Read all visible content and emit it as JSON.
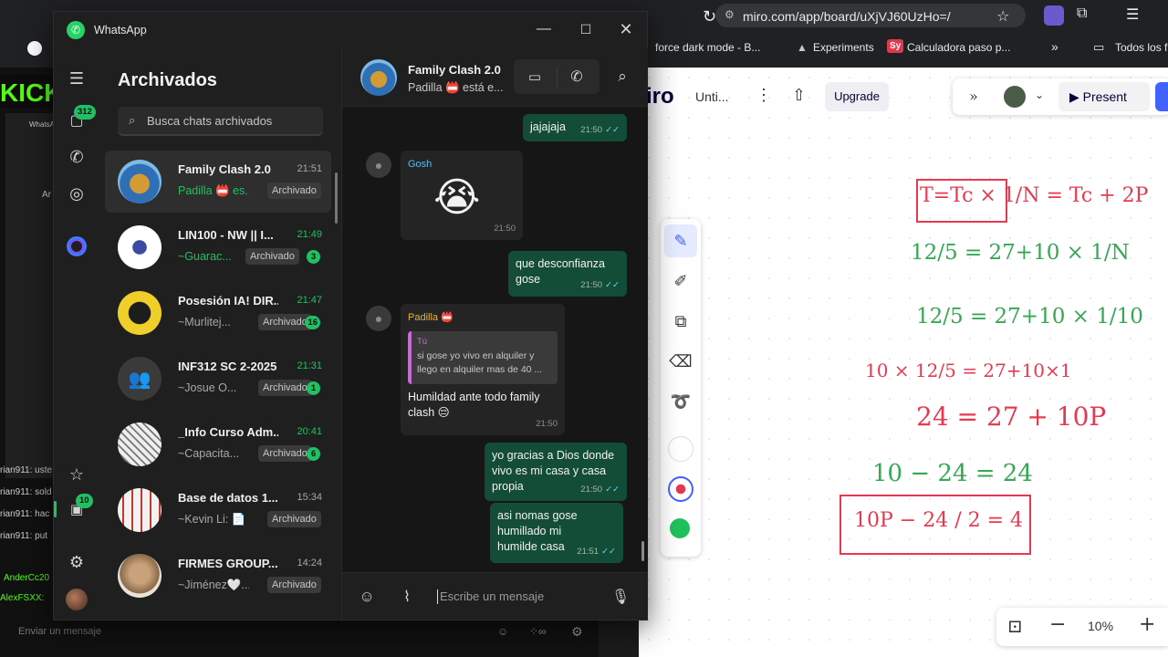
{
  "browser": {
    "url": "miro.com/app/board/uXjVJ60UzHo=/",
    "bookmarks": [
      "force dark mode - B...",
      "Experiments",
      "Calculadora paso p...",
      "Todos los f"
    ],
    "bookmark_badge": "Sy"
  },
  "stream_bg": {
    "logo": "KICK",
    "chat_lines": [
      "rian911: uste",
      "rian911: sold",
      "rian911: hac",
      "rian911: put",
      "AnderCc20",
      "AlexFSXX:"
    ],
    "input_placeholder": "Enviar un mensaje",
    "mini_title": "WhatsA",
    "mini_heading": "Ar"
  },
  "miro": {
    "logo": "iro",
    "board_name": "Unti...",
    "upgrade_label": "Upgrade",
    "present_label": "Present",
    "zoom": "10%",
    "handwriting": [
      {
        "text": "T=Tc × 1/N = Tc + 2P",
        "color": "red"
      },
      {
        "text": "12/5 = 27+10 × 1/N",
        "color": "green"
      },
      {
        "text": "12/5 = 27+10 × 1/10",
        "color": "green"
      },
      {
        "text": "10 × 12/5 = 27+10×1",
        "color": "red"
      },
      {
        "text": "24 = 27 + 10P",
        "color": "red"
      },
      {
        "text": "10 − 24 = 24",
        "color": "green"
      },
      {
        "text": "10P − 24 / 2 = 4",
        "color": "red"
      }
    ]
  },
  "whatsapp": {
    "app_title": "WhatsApp",
    "rail": {
      "chats_badge": "312",
      "archive_badge": "10"
    },
    "list_title": "Archivados",
    "search_placeholder": "Busca chats archivados",
    "archived_label": "Archivado",
    "chats": [
      {
        "name": "Family Clash 2.0",
        "time": "21:51",
        "preview": "Padilla 📛 es...",
        "unread": "",
        "preview_green": true
      },
      {
        "name": "LIN100 - NW || I...",
        "time": "21:49",
        "preview": "~Guarac...",
        "unread": "3",
        "preview_green": true
      },
      {
        "name": "Posesión IA! DIR...",
        "time": "21:47",
        "preview": "~Murlitej...",
        "unread": "16",
        "preview_green": false
      },
      {
        "name": "INF312 SC 2-2025",
        "time": "21:31",
        "preview": "~Josue O...",
        "unread": "1",
        "preview_green": false
      },
      {
        "name": "_Info Curso Adm...",
        "time": "20:41",
        "preview": "~Capacita...",
        "unread": "6",
        "preview_green": false
      },
      {
        "name": "Base de datos 1...",
        "time": "15:34",
        "preview": "~Kevin Li: 📄 ...",
        "unread": "",
        "preview_green": false
      },
      {
        "name": "FIRMES GROUP...",
        "time": "14:24",
        "preview": "~Jiménez🤍...",
        "unread": "",
        "preview_green": false
      }
    ],
    "chat": {
      "title": "Family Clash 2.0",
      "subtitle": "Padilla 📛 está e...",
      "input_placeholder": "Escribe un mensaje",
      "messages": [
        {
          "dir": "out",
          "text": "jajajaja",
          "time": "21:50"
        },
        {
          "dir": "in",
          "sender": "Gosh",
          "emoji": "😭",
          "time": "21:50"
        },
        {
          "dir": "out",
          "text": "que desconfianza gose",
          "time": "21:50"
        },
        {
          "dir": "in",
          "sender": "Padilla 📛",
          "quote_author": "Tú",
          "quote_text": "si gose yo vivo en alquiler y llego en alquiler mas de 40 ...",
          "text": "Humildad ante todo family clash 😔",
          "time": "21:50"
        },
        {
          "dir": "out",
          "text": "yo gracias a Dios donde vivo es mi casa y casa propia",
          "time": "21:50"
        },
        {
          "dir": "out",
          "text": "asi nomas gose humillado mi humilde casa",
          "time": "21:51"
        }
      ]
    }
  }
}
